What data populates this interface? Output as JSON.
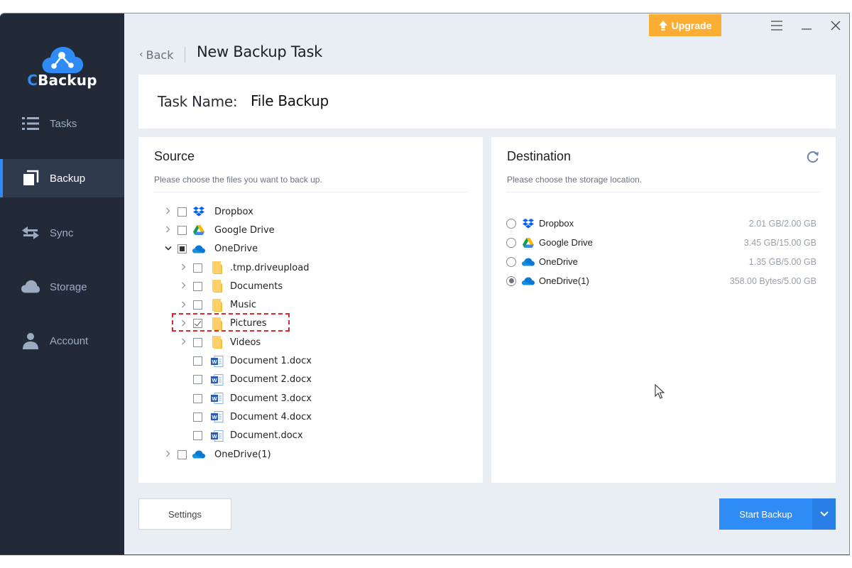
{
  "app": {
    "brand_prefix": "C",
    "brand_rest": "Backup"
  },
  "sidebar": {
    "items": [
      {
        "label": "Tasks",
        "icon": "list-icon",
        "active": false
      },
      {
        "label": "Backup",
        "icon": "backup-icon",
        "active": true
      },
      {
        "label": "Sync",
        "icon": "sync-arrows-icon",
        "active": false
      },
      {
        "label": "Storage",
        "icon": "cloud-icon",
        "active": false
      },
      {
        "label": "Account",
        "icon": "user-icon",
        "active": false
      }
    ]
  },
  "titlebar": {
    "upgrade_label": "Upgrade",
    "menu_icon": "hamburger-icon",
    "minimize_icon": "minimize-icon",
    "close_icon": "close-icon"
  },
  "header": {
    "back_label": "Back",
    "title": "New Backup Task"
  },
  "task": {
    "label": "Task Name:",
    "value": "File Backup"
  },
  "source": {
    "title": "Source",
    "subtitle": "Please choose the files you want to back up.",
    "tree": [
      {
        "name": "Dropbox",
        "icon": "dropbox",
        "level": 0,
        "expander": "collapsed",
        "check": "unchecked"
      },
      {
        "name": "Google Drive",
        "icon": "gdrive",
        "level": 0,
        "expander": "collapsed",
        "check": "unchecked"
      },
      {
        "name": "OneDrive",
        "icon": "onedrive",
        "level": 0,
        "expander": "expanded",
        "check": "partial"
      },
      {
        "name": ".tmp.driveupload",
        "icon": "folder",
        "level": 1,
        "expander": "collapsed",
        "check": "unchecked"
      },
      {
        "name": "Documents",
        "icon": "folder",
        "level": 1,
        "expander": "collapsed",
        "check": "unchecked"
      },
      {
        "name": "Music",
        "icon": "folder",
        "level": 1,
        "expander": "collapsed",
        "check": "unchecked"
      },
      {
        "name": "Pictures",
        "icon": "folder",
        "level": 1,
        "expander": "collapsed",
        "check": "checked",
        "highlighted": true
      },
      {
        "name": "Videos",
        "icon": "folder",
        "level": 1,
        "expander": "collapsed",
        "check": "unchecked"
      },
      {
        "name": "Document 1.docx",
        "icon": "word",
        "level": 1,
        "expander": "none",
        "check": "unchecked"
      },
      {
        "name": "Document 2.docx",
        "icon": "word",
        "level": 1,
        "expander": "none",
        "check": "unchecked"
      },
      {
        "name": "Document 3.docx",
        "icon": "word",
        "level": 1,
        "expander": "none",
        "check": "unchecked"
      },
      {
        "name": "Document 4.docx",
        "icon": "word",
        "level": 1,
        "expander": "none",
        "check": "unchecked"
      },
      {
        "name": "Document.docx",
        "icon": "word",
        "level": 1,
        "expander": "none",
        "check": "unchecked"
      },
      {
        "name": "OneDrive(1)",
        "icon": "onedrive",
        "level": 0,
        "expander": "collapsed",
        "check": "unchecked"
      }
    ]
  },
  "destination": {
    "title": "Destination",
    "subtitle": "Please choose the storage location.",
    "refresh_icon": "refresh-icon",
    "items": [
      {
        "name": "Dropbox",
        "icon": "dropbox",
        "capacity": "2.01 GB/2.00 GB",
        "selected": false
      },
      {
        "name": "Google Drive",
        "icon": "gdrive",
        "capacity": "3.45 GB/15.00 GB",
        "selected": false
      },
      {
        "name": "OneDrive",
        "icon": "onedrive",
        "capacity": "1.35 GB/5.00 GB",
        "selected": false
      },
      {
        "name": "OneDrive(1)",
        "icon": "onedrive",
        "capacity": "358.00 Bytes/5.00 GB",
        "selected": true
      }
    ]
  },
  "footer": {
    "settings_label": "Settings",
    "start_label": "Start Backup"
  },
  "colors": {
    "sidebar_bg": "#222a37",
    "sidebar_active_bg": "#2f3a4c",
    "accent": "#2f8cf6",
    "upgrade": "#fbae33",
    "highlight_border": "#e0262a",
    "content_bg": "#e9eef4"
  }
}
